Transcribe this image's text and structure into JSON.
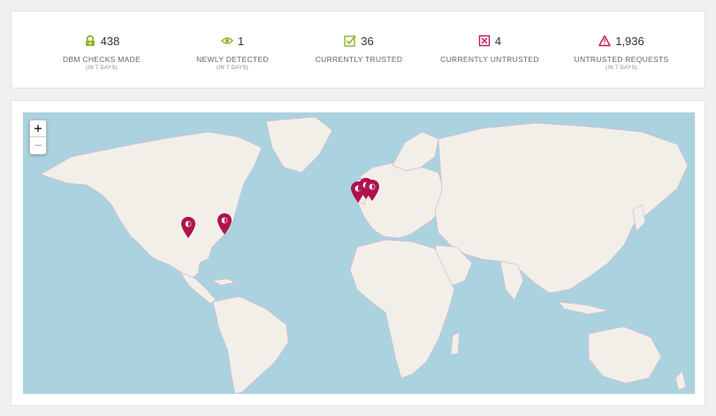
{
  "stats": [
    {
      "icon": "dbm-check-icon",
      "color": "#8bb627",
      "value": "438",
      "label": "DBM CHECKS MADE",
      "sub": "(IN 7 DAYS)"
    },
    {
      "icon": "eye-icon",
      "color": "#8bb627",
      "value": "1",
      "label": "NEWLY DETECTED",
      "sub": "(IN 7 DAYS)"
    },
    {
      "icon": "checkbox-checked-icon",
      "color": "#8bb627",
      "value": "36",
      "label": "CURRENTLY TRUSTED",
      "sub": ""
    },
    {
      "icon": "checkbox-x-icon",
      "color": "#c2185b",
      "value": "4",
      "label": "CURRENTLY UNTRUSTED",
      "sub": ""
    },
    {
      "icon": "warning-triangle-icon",
      "color": "#c2185b",
      "value": "1,936",
      "label": "UNTRUSTED REQUESTS",
      "sub": "(IN 7 DAYS)"
    }
  ],
  "map": {
    "zoom_in": "+",
    "zoom_out": "−",
    "water_color": "#aad3df",
    "land_color": "#f2efe9",
    "marker_color": "#b0124d",
    "markers": [
      {
        "name": "marker-central-us"
      },
      {
        "name": "marker-east-us"
      },
      {
        "name": "marker-uk"
      },
      {
        "name": "marker-netherlands"
      },
      {
        "name": "marker-germany"
      }
    ]
  }
}
